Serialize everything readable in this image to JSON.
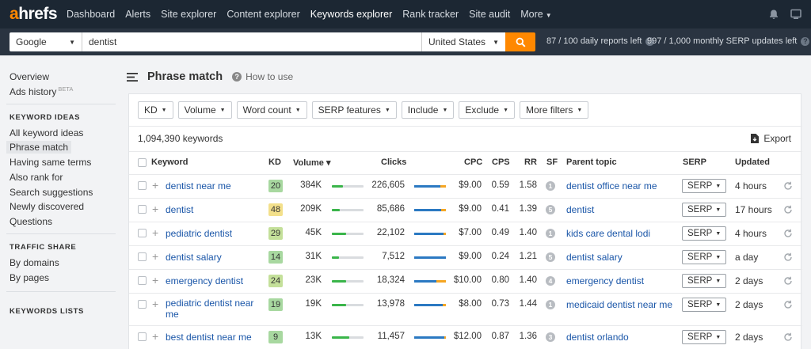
{
  "nav": {
    "logo_a": "a",
    "logo_rest": "hrefs",
    "links": [
      "Dashboard",
      "Alerts",
      "Site explorer",
      "Content explorer",
      "Keywords explorer",
      "Rank tracker",
      "Site audit",
      "More"
    ],
    "active_index": 4,
    "icons": [
      "bell-icon",
      "monitor-icon"
    ]
  },
  "search": {
    "engine": "Google",
    "query": "dentist",
    "country": "United States",
    "daily_reports": "87 / 100 daily reports left",
    "monthly_updates": "997 / 1,000 monthly SERP updates left"
  },
  "sidebar": {
    "top_items": [
      "Overview",
      "Ads history"
    ],
    "beta": "BETA",
    "sections": [
      {
        "title": "KEYWORD IDEAS",
        "items": [
          "All keyword ideas",
          "Phrase match",
          "Having same terms",
          "Also rank for",
          "Search suggestions",
          "Newly discovered",
          "Questions"
        ]
      },
      {
        "title": "TRAFFIC SHARE",
        "items": [
          "By domains",
          "By pages"
        ]
      },
      {
        "title": "KEYWORDS LISTS",
        "items": []
      }
    ],
    "active_item": "Phrase match"
  },
  "page": {
    "title": "Phrase match",
    "how_to": "How to use"
  },
  "filters": [
    "KD",
    "Volume",
    "Word count",
    "SERP features",
    "Include",
    "Exclude",
    "More filters"
  ],
  "results": {
    "count": "1,094,390 keywords",
    "export_label": "Export"
  },
  "table": {
    "headers": {
      "keyword": "Keyword",
      "kd": "KD",
      "volume": "Volume",
      "clicks": "Clicks",
      "cpc": "CPC",
      "cps": "CPS",
      "rr": "RR",
      "sf": "SF",
      "parent": "Parent topic",
      "serp": "SERP",
      "updated": "Updated"
    },
    "sort_indicator": "▾",
    "rows": [
      {
        "keyword": [
          "dentist near me"
        ],
        "kd": "20",
        "kd_color": "#a8d8a0",
        "volume": "384K",
        "volume_fill": 0.35,
        "clicks": "226,605",
        "clicks_split": [
          0.82,
          0.18
        ],
        "cpc": "$9.00",
        "cps": "0.59",
        "rr": "1.58",
        "sf": "1",
        "parent": "dentist office near me",
        "serp": "SERP",
        "updated": "4 hours"
      },
      {
        "keyword": [
          "dentist"
        ],
        "kd": "48",
        "kd_color": "#f3e08b",
        "volume": "209K",
        "volume_fill": 0.25,
        "clicks": "85,686",
        "clicks_split": [
          0.85,
          0.15
        ],
        "cpc": "$9.00",
        "cps": "0.41",
        "rr": "1.39",
        "sf": "5",
        "parent": "dentist",
        "serp": "SERP",
        "updated": "17 hours"
      },
      {
        "keyword": [
          "pediatric dentist"
        ],
        "kd": "29",
        "kd_color": "#c4e09a",
        "volume": "45K",
        "volume_fill": 0.45,
        "clicks": "22,102",
        "clicks_split": [
          0.92,
          0.08
        ],
        "cpc": "$7.00",
        "cps": "0.49",
        "rr": "1.40",
        "sf": "1",
        "parent": "kids care dental lodi",
        "serp": "SERP",
        "updated": "4 hours"
      },
      {
        "keyword": [
          "dentist salary"
        ],
        "kd": "14",
        "kd_color": "#a8d8a0",
        "volume": "31K",
        "volume_fill": 0.22,
        "clicks": "7,512",
        "clicks_split": [
          1.0,
          0.0
        ],
        "cpc": "$9.00",
        "cps": "0.24",
        "rr": "1.21",
        "sf": "5",
        "parent": "dentist salary",
        "serp": "SERP",
        "updated": "a day"
      },
      {
        "keyword": [
          "emergency dentist"
        ],
        "kd": "24",
        "kd_color": "#c4e09a",
        "volume": "23K",
        "volume_fill": 0.45,
        "clicks": "18,324",
        "clicks_split": [
          0.7,
          0.3
        ],
        "cpc": "$10.00",
        "cps": "0.80",
        "rr": "1.40",
        "sf": "4",
        "parent": "emergency dentist",
        "serp": "SERP",
        "updated": "2 days"
      },
      {
        "keyword": [
          "pediatric dentist near",
          "me"
        ],
        "kd": "19",
        "kd_color": "#a8d8a0",
        "volume": "19K",
        "volume_fill": 0.45,
        "clicks": "13,978",
        "clicks_split": [
          0.9,
          0.1
        ],
        "cpc": "$8.00",
        "cps": "0.73",
        "rr": "1.44",
        "sf": "1",
        "parent": "medicaid dentist near me",
        "serp": "SERP",
        "updated": "2 days"
      },
      {
        "keyword": [
          "best dentist near me"
        ],
        "kd": "9",
        "kd_color": "#a8d8a0",
        "volume": "13K",
        "volume_fill": 0.55,
        "clicks": "11,457",
        "clicks_split": [
          0.95,
          0.05
        ],
        "cpc": "$12.00",
        "cps": "0.87",
        "rr": "1.36",
        "sf": "3",
        "parent": "dentist orlando",
        "serp": "SERP",
        "updated": "2 days"
      }
    ]
  },
  "colors": {
    "accent": "#ff8800",
    "link": "#1a56a8",
    "paid_clicks": "#f5a623",
    "organic_clicks": "#2b79c2",
    "volume_bar": "#3ab54a"
  }
}
